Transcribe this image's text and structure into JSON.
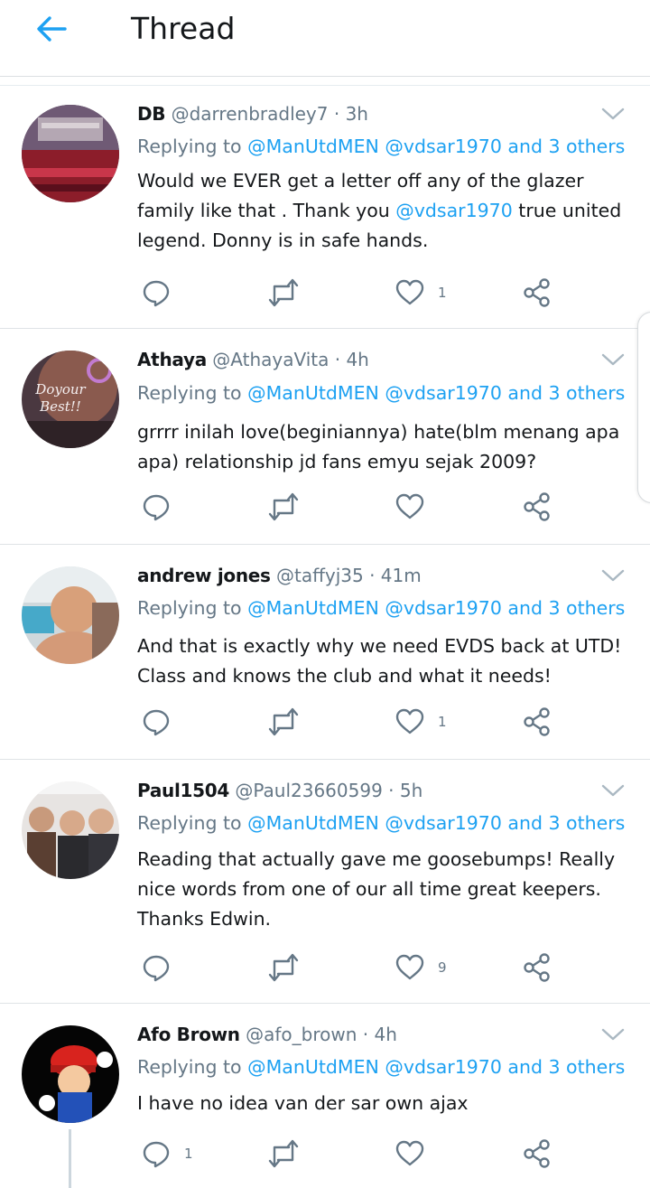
{
  "header": {
    "title": "Thread",
    "back_icon": "arrow-left-icon",
    "accent": "#1da1f2"
  },
  "tweets": [
    {
      "name": "DB",
      "handle": "@darrenbradley7",
      "time": "3h",
      "reply_prefix": "Replying to",
      "reply_mentions": "@ManUtdMEN @vdsar1970 and 3 others",
      "body_parts": [
        "Would we EVER get a letter off any of the glazer family like that . Thank you ",
        "@vdsar1970",
        " true united legend. Donny is in safe hands."
      ],
      "reply_count": "",
      "retweet_count": "",
      "like_count": "1"
    },
    {
      "name": "Athaya",
      "handle": "@AthayaVita",
      "time": "4h",
      "reply_prefix": "Replying to",
      "reply_mentions": "@ManUtdMEN @vdsar1970 and 3 others",
      "body": "grrrr inilah love(beginiannya) hate(blm menang apa apa) relationship jd fans emyu sejak 2009?",
      "avatar_text": "Doyour Best!!",
      "reply_count": "",
      "retweet_count": "",
      "like_count": ""
    },
    {
      "name": "andrew jones",
      "handle": "@taffyj35",
      "time": "41m",
      "reply_prefix": "Replying to",
      "reply_mentions": "@ManUtdMEN @vdsar1970 and 3 others",
      "body": "And that is exactly why we need EVDS back at UTD! Class and knows the club and what it needs!",
      "reply_count": "",
      "retweet_count": "",
      "like_count": "1"
    },
    {
      "name": "Paul1504",
      "handle": "@Paul23660599",
      "time": "5h",
      "reply_prefix": "Replying to",
      "reply_mentions": "@ManUtdMEN @vdsar1970 and 3 others",
      "body": "Reading that actually gave me goosebumps! Really nice words from one of our all time great keepers. Thanks Edwin.",
      "reply_count": "",
      "retweet_count": "",
      "like_count": "9"
    },
    {
      "name": "Afo Brown",
      "handle": "@afo_brown",
      "time": "4h",
      "reply_prefix": "Replying to",
      "reply_mentions": "@ManUtdMEN @vdsar1970 and 3 others",
      "body": "I have no idea van der sar own ajax",
      "reply_count": "1",
      "retweet_count": "",
      "like_count": ""
    }
  ],
  "icons": {
    "reply": "speech-bubble-icon",
    "retweet": "retweet-icon",
    "like": "heart-icon",
    "share": "share-icon",
    "more": "chevron-down-icon"
  },
  "colors": {
    "text": "#14171a",
    "muted": "#657786",
    "link": "#1da1f2",
    "divider": "#dfe3e6"
  }
}
